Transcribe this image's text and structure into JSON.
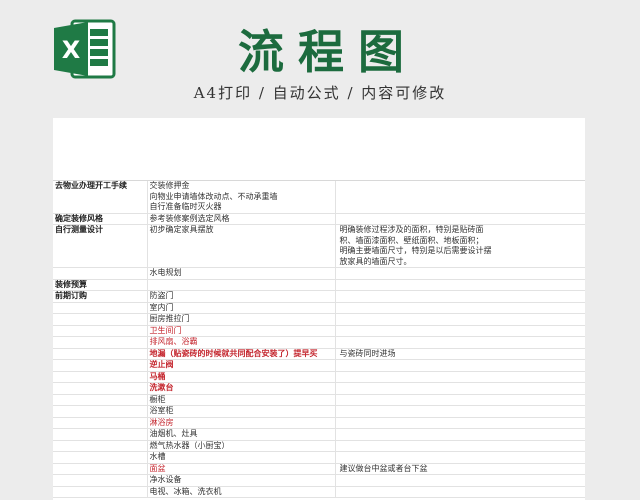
{
  "banner": {
    "title": "流程图",
    "subtitle": "A4打印 / 自动公式 / 内容可修改",
    "logo_letter": "X",
    "colors": {
      "brand_green": "#1c6b3e",
      "excel_green": "#1f7a45",
      "highlight_red": "#c4262e"
    }
  },
  "table": {
    "rows": [
      {
        "a": "去物业办理开工手续",
        "b": [
          "交装修押金",
          "向物业申请墙体改动点、不动承重墙",
          "自行准备临时灭火器"
        ],
        "c": []
      },
      {
        "a": "确定装修风格",
        "b": [
          "参考装修案例选定风格"
        ],
        "c": []
      },
      {
        "a": "自行测量设计",
        "b": [
          "初步确定家具摆放",
          "",
          "",
          ""
        ],
        "c": [
          "明确装修过程涉及的面积，特别是贴砖面",
          "积、墙面漆面积、壁纸面积、地板面积；",
          "明确主要墙面尺寸，特别是以后需要设计摆",
          "放家具的墙面尺寸。"
        ]
      },
      {
        "a": "",
        "b": [
          "水电规划"
        ],
        "c": []
      },
      {
        "a": "装修预算",
        "b": [
          ""
        ],
        "c": []
      },
      {
        "a": "前期订购",
        "b": [
          "防盗门"
        ],
        "c": []
      },
      {
        "a": "",
        "b": [
          "室内门"
        ],
        "c": []
      },
      {
        "a": "",
        "b": [
          "厨房推拉门"
        ],
        "c": []
      },
      {
        "a": "",
        "b": [
          "卫生间门"
        ],
        "c": [],
        "style": "red"
      },
      {
        "a": "",
        "b": [
          "排风扇、浴霸"
        ],
        "c": [],
        "style": "red"
      },
      {
        "a": "",
        "b": [
          "地漏（贴瓷砖的时候就共同配合安装了）提早买"
        ],
        "c": [
          "与瓷砖同时进场"
        ],
        "style": "redb"
      },
      {
        "a": "",
        "b": [
          "逆止阀"
        ],
        "c": [],
        "style": "redb"
      },
      {
        "a": "",
        "b": [
          "马桶"
        ],
        "c": [],
        "style": "redb"
      },
      {
        "a": "",
        "b": [
          "洗漱台"
        ],
        "c": [],
        "style": "redb"
      },
      {
        "a": "",
        "b": [
          "橱柜"
        ],
        "c": []
      },
      {
        "a": "",
        "b": [
          "浴室柜"
        ],
        "c": []
      },
      {
        "a": "",
        "b": [
          "淋浴房"
        ],
        "c": [],
        "style": "red"
      },
      {
        "a": "",
        "b": [
          "油烟机、灶具"
        ],
        "c": []
      },
      {
        "a": "",
        "b": [
          "燃气热水器（小厨宝）"
        ],
        "c": []
      },
      {
        "a": "",
        "b": [
          "水槽"
        ],
        "c": []
      },
      {
        "a": "",
        "b": [
          "面盆"
        ],
        "c": [
          "建议做台中盆或者台下盆"
        ],
        "style": "red"
      },
      {
        "a": "",
        "b": [
          "净水设备"
        ],
        "c": []
      },
      {
        "a": "",
        "b": [
          "电视、冰箱、洗衣机"
        ],
        "c": []
      }
    ]
  }
}
